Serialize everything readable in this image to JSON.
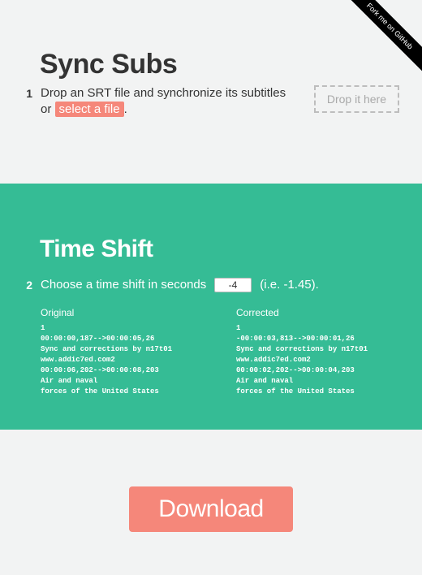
{
  "ribbon": {
    "label": "Fork me on GitHub"
  },
  "section1": {
    "title": "Sync Subs",
    "step": "1",
    "desc_a": "Drop an SRT file and synchronize its subtitles or ",
    "select_label": "select a file",
    "desc_b": ".",
    "dropzone": "Drop it here"
  },
  "section2": {
    "title": "Time Shift",
    "step": "2",
    "desc_a": "Choose a time shift in seconds",
    "shift_value": "-4",
    "desc_b": "(i.e. -1.45).",
    "original_label": "Original",
    "corrected_label": "Corrected",
    "original_text": "1\n00:00:00,187-->00:00:05,26\nSync and corrections by n17t01\nwww.addic7ed.com2\n00:00:06,202-->00:00:08,203\nAir and naval\nforces of the United States",
    "corrected_text": "1\n-00:00:03,813-->00:00:01,26\nSync and corrections by n17t01\nwww.addic7ed.com2\n00:00:02,202-->00:00:04,203\nAir and naval\nforces of the United States"
  },
  "section3": {
    "download": "Download"
  }
}
